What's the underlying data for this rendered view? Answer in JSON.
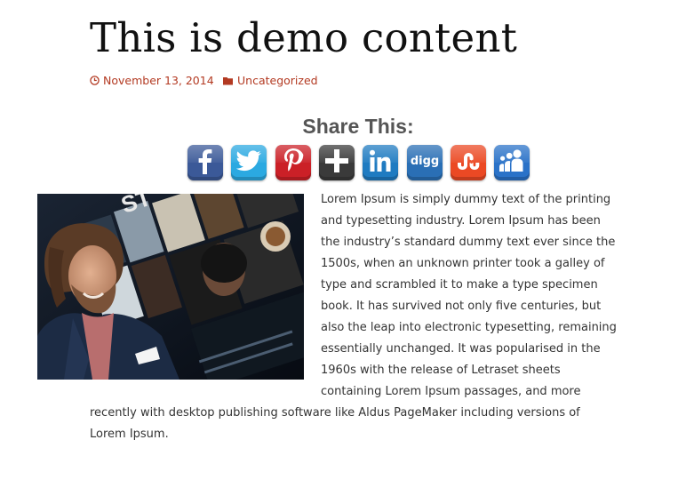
{
  "post": {
    "title": "This is demo content",
    "meta": {
      "date": "November 13, 2014",
      "date_icon": "clock-icon",
      "category": "Uncategorized",
      "category_icon": "folder-icon",
      "accent_color": "#b33a22"
    }
  },
  "share": {
    "heading": "Share This:",
    "buttons": [
      {
        "name": "facebook",
        "icon": "facebook-icon",
        "color": "#3b5998"
      },
      {
        "name": "twitter",
        "icon": "twitter-icon",
        "color": "#2ba9e1"
      },
      {
        "name": "pinterest",
        "icon": "pinterest-icon",
        "color": "#cb2027"
      },
      {
        "name": "google-plus",
        "icon": "plus-icon",
        "color": "#3a3a3a"
      },
      {
        "name": "linkedin",
        "icon": "linkedin-icon",
        "color": "#1f7bc1"
      },
      {
        "name": "digg",
        "icon": "digg-icon",
        "color": "#2a6fb5"
      },
      {
        "name": "stumbleupon",
        "icon": "stumbleupon-icon",
        "color": "#eb4924"
      },
      {
        "name": "myspace",
        "icon": "myspace-icon",
        "color": "#2a72c8"
      }
    ]
  },
  "content": {
    "image": "man-smiling-photo",
    "lines_beside_image": [
      "Lorem Ipsum is simply dummy text of the printing",
      "and typesetting industry. Lorem Ipsum has been",
      "the industry’s standard dummy text ever since the",
      "1500s, when an unknown printer took a galley of",
      "type and scrambled it to make a type specimen",
      "book. It has survived not only five centuries, but",
      "also the leap into electronic typesetting, remaining",
      "essentially unchanged. It was popularised in the",
      "1960s with the release of Letraset sheets",
      "containing Lorem Ipsum passages, and more"
    ],
    "lines_full_width": [
      "recently with desktop publishing software like Aldus PageMaker including versions of",
      "Lorem Ipsum."
    ]
  }
}
